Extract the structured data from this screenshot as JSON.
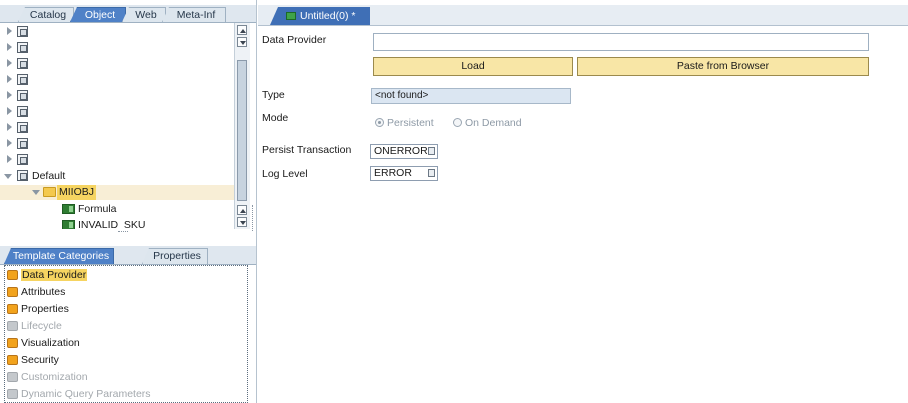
{
  "top_tabs": [
    "Catalog",
    "Object",
    "Web",
    "Meta-Inf"
  ],
  "tree": {
    "default_label": "Default",
    "folder_label": "MIIOBJ",
    "children": [
      "Formula",
      "INVALID_SKU"
    ]
  },
  "bottom_tabs": [
    "Template Categories",
    "Properties"
  ],
  "categories": [
    {
      "label": "Data Provider",
      "enabled": true
    },
    {
      "label": "Attributes",
      "enabled": true
    },
    {
      "label": "Properties",
      "enabled": true
    },
    {
      "label": "Lifecycle",
      "enabled": false
    },
    {
      "label": "Visualization",
      "enabled": true
    },
    {
      "label": "Security",
      "enabled": true
    },
    {
      "label": "Customization",
      "enabled": false
    },
    {
      "label": "Dynamic Query Parameters",
      "enabled": false
    }
  ],
  "document_tab": "Untitled(0) *",
  "form": {
    "data_provider_label": "Data Provider",
    "data_provider_value": "",
    "load_button": "Load",
    "paste_button": "Paste from Browser",
    "type_label": "Type",
    "type_value": "<not found>",
    "mode_label": "Mode",
    "mode_options": [
      "Persistent",
      "On Demand"
    ],
    "mode_selected": "Persistent",
    "persist_label": "Persist Transaction",
    "persist_value": "ONERROR",
    "log_label": "Log Level",
    "log_value": "ERROR"
  },
  "colors": {
    "active_tab": "#4f81c7",
    "selection": "#f6d461",
    "button_fill": "#f8e6a6",
    "category_icon": "#f2a31d"
  }
}
